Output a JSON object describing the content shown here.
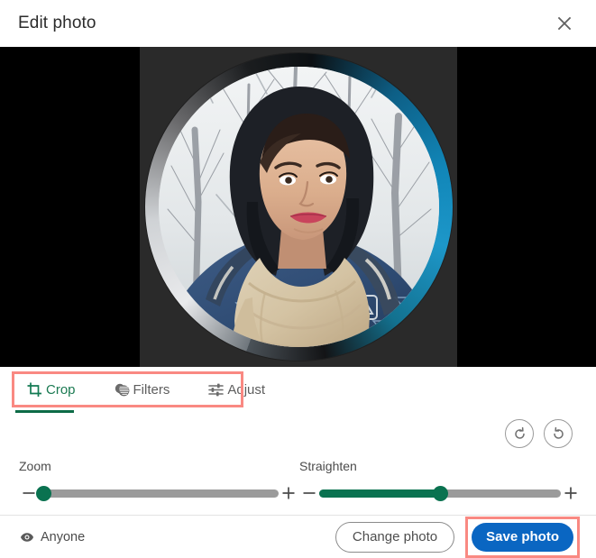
{
  "header": {
    "title": "Edit photo",
    "close_icon": "close-icon"
  },
  "stage": {
    "photo_alt": "profile-photo-circular-crop",
    "background_color": "#000000",
    "ring_accent_color": "#1186b8"
  },
  "tabs": {
    "items": [
      {
        "label": "Crop",
        "icon": "crop-icon",
        "active": true
      },
      {
        "label": "Filters",
        "icon": "filters-icon",
        "active": false
      },
      {
        "label": "Adjust",
        "icon": "adjust-icon",
        "active": false
      }
    ],
    "active_color": "#1b7a52",
    "highlight_color": "#f98982"
  },
  "rotate": {
    "clockwise_icon": "rotate-clockwise-icon",
    "counter_clockwise_icon": "rotate-counter-clockwise-icon"
  },
  "sliders": {
    "zoom": {
      "label": "Zoom",
      "value": 0,
      "min": 0,
      "max": 100,
      "minus_icon": "minus-icon",
      "plus_icon": "plus-icon"
    },
    "straighten": {
      "label": "Straighten",
      "value": 50,
      "min": 0,
      "max": 100,
      "minus_icon": "minus-icon",
      "plus_icon": "plus-icon"
    },
    "accent_color": "#0a7250",
    "track_color": "#9b9b9b"
  },
  "footer": {
    "visibility_label": "Anyone",
    "visibility_icon": "eye-icon",
    "change_photo_label": "Change photo",
    "save_photo_label": "Save photo",
    "primary_color": "#0a66c2",
    "highlight_color": "#f98982"
  }
}
